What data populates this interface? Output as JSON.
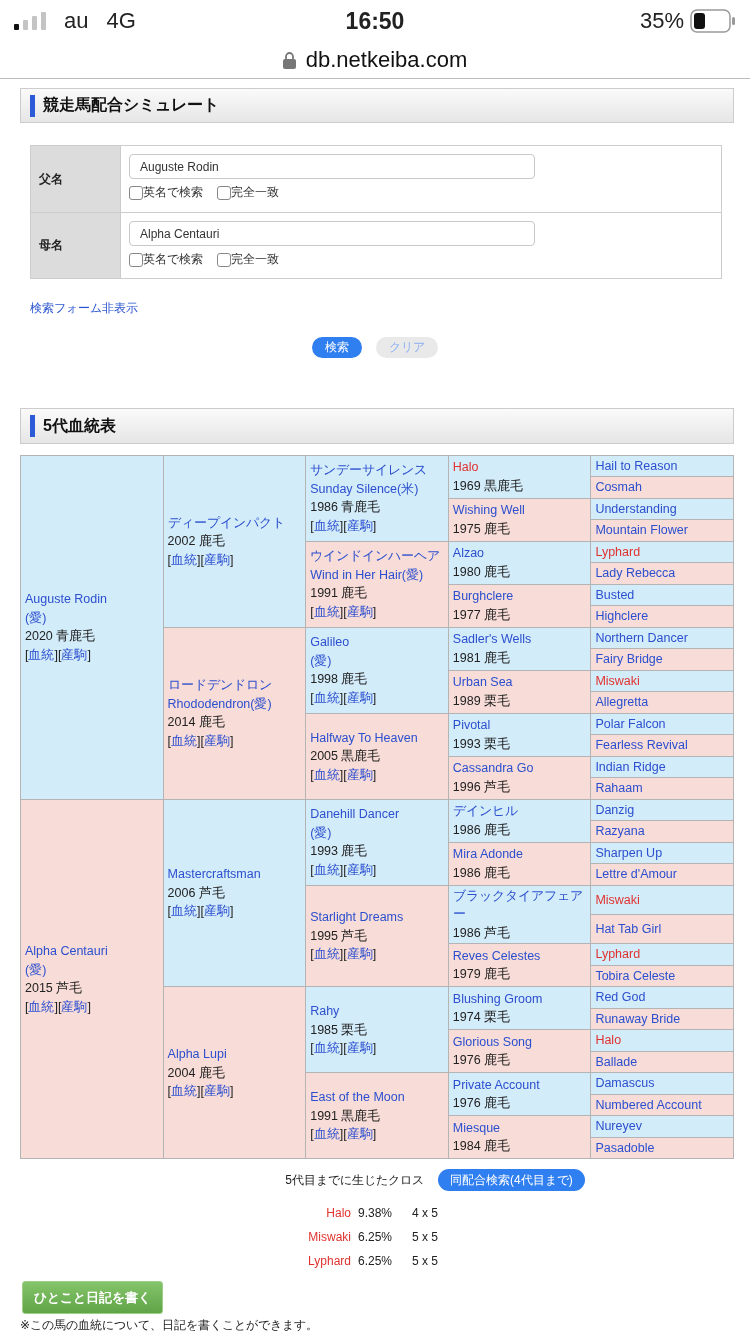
{
  "status_bar": {
    "carrier": "au",
    "network": "4G",
    "time": "16:50",
    "battery": "35%"
  },
  "url": "db.netkeiba.com",
  "search_section": {
    "title": "競走馬配合シミュレート",
    "fields": [
      {
        "label": "父名",
        "value": "Auguste Rodin",
        "options": [
          {
            "label": "英名で検索",
            "checked": false
          },
          {
            "label": "完全一致",
            "checked": false
          }
        ]
      },
      {
        "label": "母名",
        "value": "Alpha Centauri",
        "options": [
          {
            "label": "英名で検索",
            "checked": false
          },
          {
            "label": "完全一致",
            "checked": false
          }
        ]
      }
    ],
    "toggle_link": "検索フォーム非表示",
    "buttons": [
      {
        "label": "検索",
        "kind": "primary"
      },
      {
        "label": "クリア",
        "kind": "secondary"
      }
    ]
  },
  "pedigree": {
    "title": "5代血統表",
    "horses": [
      {
        "kind": "sire",
        "cross": false,
        "names": [
          "Auguste Rodin",
          "(愛)"
        ],
        "info": "2020 青鹿毛",
        "links": [
          "[血統]",
          "[産駒]"
        ],
        "children": [
          {
            "kind": "sire",
            "cross": false,
            "names": [
              "ディープインパクト"
            ],
            "info": "2002 鹿毛",
            "links": [
              "[血統]",
              "[産駒]"
            ],
            "children": [
              {
                "kind": "sire",
                "cross": false,
                "names": [
                  "サンデーサイレンス",
                  "Sunday Silence(米)"
                ],
                "info": "1986 青鹿毛",
                "links": [
                  "[血統]",
                  "[産駒]"
                ],
                "children": [
                  {
                    "kind": "sire",
                    "cross": true,
                    "names": [
                      "Halo"
                    ],
                    "info": "1969 黒鹿毛",
                    "children": [
                      {
                        "kind": "sire",
                        "cross": false,
                        "names": [
                          "Hail to Reason"
                        ]
                      },
                      {
                        "kind": "dam",
                        "cross": false,
                        "names": [
                          "Cosmah"
                        ]
                      }
                    ]
                  },
                  {
                    "kind": "dam",
                    "cross": false,
                    "names": [
                      "Wishing Well"
                    ],
                    "info": "1975 鹿毛",
                    "children": [
                      {
                        "kind": "sire",
                        "cross": false,
                        "names": [
                          "Understanding"
                        ]
                      },
                      {
                        "kind": "dam",
                        "cross": false,
                        "names": [
                          "Mountain Flower"
                        ]
                      }
                    ]
                  }
                ]
              },
              {
                "kind": "dam",
                "cross": false,
                "names": [
                  "ウインドインハーヘア",
                  "Wind in Her Hair(愛)"
                ],
                "info": "1991 鹿毛",
                "links": [
                  "[血統]",
                  "[産駒]"
                ],
                "children": [
                  {
                    "kind": "sire",
                    "cross": false,
                    "names": [
                      "Alzao"
                    ],
                    "info": "1980 鹿毛",
                    "children": [
                      {
                        "kind": "sire",
                        "cross": true,
                        "names": [
                          "Lyphard"
                        ]
                      },
                      {
                        "kind": "dam",
                        "cross": false,
                        "names": [
                          "Lady Rebecca"
                        ]
                      }
                    ]
                  },
                  {
                    "kind": "dam",
                    "cross": false,
                    "names": [
                      "Burghclere"
                    ],
                    "info": "1977 鹿毛",
                    "children": [
                      {
                        "kind": "sire",
                        "cross": false,
                        "names": [
                          "Busted"
                        ]
                      },
                      {
                        "kind": "dam",
                        "cross": false,
                        "names": [
                          "Highclere"
                        ]
                      }
                    ]
                  }
                ]
              }
            ]
          },
          {
            "kind": "dam",
            "cross": false,
            "names": [
              "ロードデンドロン",
              "Rhododendron(愛)"
            ],
            "info": "2014 鹿毛",
            "links": [
              "[血統]",
              "[産駒]"
            ],
            "children": [
              {
                "kind": "sire",
                "cross": false,
                "names": [
                  "Galileo",
                  "(愛)"
                ],
                "info": "1998 鹿毛",
                "links": [
                  "[血統]",
                  "[産駒]"
                ],
                "children": [
                  {
                    "kind": "sire",
                    "cross": false,
                    "names": [
                      "Sadler's Wells"
                    ],
                    "info": "1981 鹿毛",
                    "children": [
                      {
                        "kind": "sire",
                        "cross": false,
                        "names": [
                          "Northern Dancer"
                        ]
                      },
                      {
                        "kind": "dam",
                        "cross": false,
                        "names": [
                          "Fairy Bridge"
                        ]
                      }
                    ]
                  },
                  {
                    "kind": "dam",
                    "cross": false,
                    "names": [
                      "Urban Sea"
                    ],
                    "info": "1989 栗毛",
                    "children": [
                      {
                        "kind": "sire",
                        "cross": true,
                        "names": [
                          "Miswaki"
                        ]
                      },
                      {
                        "kind": "dam",
                        "cross": false,
                        "names": [
                          "Allegretta"
                        ]
                      }
                    ]
                  }
                ]
              },
              {
                "kind": "dam",
                "cross": false,
                "names": [
                  "Halfway To Heaven"
                ],
                "info": "2005 黒鹿毛",
                "links": [
                  "[血統]",
                  "[産駒]"
                ],
                "children": [
                  {
                    "kind": "sire",
                    "cross": false,
                    "names": [
                      "Pivotal"
                    ],
                    "info": "1993 栗毛",
                    "children": [
                      {
                        "kind": "sire",
                        "cross": false,
                        "names": [
                          "Polar Falcon"
                        ]
                      },
                      {
                        "kind": "dam",
                        "cross": false,
                        "names": [
                          "Fearless Revival"
                        ]
                      }
                    ]
                  },
                  {
                    "kind": "dam",
                    "cross": false,
                    "names": [
                      "Cassandra Go"
                    ],
                    "info": "1996 芦毛",
                    "children": [
                      {
                        "kind": "sire",
                        "cross": false,
                        "names": [
                          "Indian Ridge"
                        ]
                      },
                      {
                        "kind": "dam",
                        "cross": false,
                        "names": [
                          "Rahaam"
                        ]
                      }
                    ]
                  }
                ]
              }
            ]
          }
        ]
      },
      {
        "kind": "dam",
        "cross": false,
        "names": [
          "Alpha Centauri",
          "(愛)"
        ],
        "info": "2015 芦毛",
        "links": [
          "[血統]",
          "[産駒]"
        ],
        "children": [
          {
            "kind": "sire",
            "cross": false,
            "names": [
              "Mastercraftsman"
            ],
            "info": "2006 芦毛",
            "links": [
              "[血統]",
              "[産駒]"
            ],
            "children": [
              {
                "kind": "sire",
                "cross": false,
                "names": [
                  "Danehill Dancer",
                  "(愛)"
                ],
                "info": "1993 鹿毛",
                "links": [
                  "[血統]",
                  "[産駒]"
                ],
                "children": [
                  {
                    "kind": "sire",
                    "cross": false,
                    "names": [
                      "デインヒル"
                    ],
                    "info": "1986 鹿毛",
                    "children": [
                      {
                        "kind": "sire",
                        "cross": false,
                        "names": [
                          "Danzig"
                        ]
                      },
                      {
                        "kind": "dam",
                        "cross": false,
                        "names": [
                          "Razyana"
                        ]
                      }
                    ]
                  },
                  {
                    "kind": "dam",
                    "cross": false,
                    "names": [
                      "Mira Adonde"
                    ],
                    "info": "1986 鹿毛",
                    "children": [
                      {
                        "kind": "sire",
                        "cross": false,
                        "names": [
                          "Sharpen Up"
                        ]
                      },
                      {
                        "kind": "dam",
                        "cross": false,
                        "names": [
                          "Lettre d'Amour"
                        ]
                      }
                    ]
                  }
                ]
              },
              {
                "kind": "dam",
                "cross": false,
                "names": [
                  "Starlight Dreams"
                ],
                "info": "1995 芦毛",
                "links": [
                  "[血統]",
                  "[産駒]"
                ],
                "children": [
                  {
                    "kind": "sire",
                    "cross": false,
                    "names": [
                      "ブラックタイアフェアー"
                    ],
                    "info": "1986 芦毛",
                    "children": [
                      {
                        "kind": "sire",
                        "cross": true,
                        "names": [
                          "Miswaki"
                        ]
                      },
                      {
                        "kind": "dam",
                        "cross": false,
                        "names": [
                          "Hat Tab Girl"
                        ]
                      }
                    ]
                  },
                  {
                    "kind": "dam",
                    "cross": false,
                    "names": [
                      "Reves Celestes"
                    ],
                    "info": "1979 鹿毛",
                    "children": [
                      {
                        "kind": "sire",
                        "cross": true,
                        "names": [
                          "Lyphard"
                        ]
                      },
                      {
                        "kind": "dam",
                        "cross": false,
                        "names": [
                          "Tobira Celeste"
                        ]
                      }
                    ]
                  }
                ]
              }
            ]
          },
          {
            "kind": "dam",
            "cross": false,
            "names": [
              "Alpha Lupi"
            ],
            "info": "2004 鹿毛",
            "links": [
              "[血統]",
              "[産駒]"
            ],
            "children": [
              {
                "kind": "sire",
                "cross": false,
                "names": [
                  "Rahy"
                ],
                "info": "1985 栗毛",
                "links": [
                  "[血統]",
                  "[産駒]"
                ],
                "children": [
                  {
                    "kind": "sire",
                    "cross": false,
                    "names": [
                      "Blushing Groom"
                    ],
                    "info": "1974 栗毛",
                    "children": [
                      {
                        "kind": "sire",
                        "cross": false,
                        "names": [
                          "Red God"
                        ]
                      },
                      {
                        "kind": "dam",
                        "cross": false,
                        "names": [
                          "Runaway Bride"
                        ]
                      }
                    ]
                  },
                  {
                    "kind": "dam",
                    "cross": false,
                    "names": [
                      "Glorious Song"
                    ],
                    "info": "1976 鹿毛",
                    "children": [
                      {
                        "kind": "sire",
                        "cross": true,
                        "names": [
                          "Halo"
                        ]
                      },
                      {
                        "kind": "dam",
                        "cross": false,
                        "names": [
                          "Ballade"
                        ]
                      }
                    ]
                  }
                ]
              },
              {
                "kind": "dam",
                "cross": false,
                "names": [
                  "East of the Moon"
                ],
                "info": "1991 黒鹿毛",
                "links": [
                  "[血統]",
                  "[産駒]"
                ],
                "children": [
                  {
                    "kind": "sire",
                    "cross": false,
                    "names": [
                      "Private Account"
                    ],
                    "info": "1976 鹿毛",
                    "children": [
                      {
                        "kind": "sire",
                        "cross": false,
                        "names": [
                          "Damascus"
                        ]
                      },
                      {
                        "kind": "dam",
                        "cross": false,
                        "names": [
                          "Numbered Account"
                        ]
                      }
                    ]
                  },
                  {
                    "kind": "dam",
                    "cross": false,
                    "names": [
                      "Miesque"
                    ],
                    "info": "1984 鹿毛",
                    "children": [
                      {
                        "kind": "sire",
                        "cross": false,
                        "names": [
                          "Nureyev"
                        ]
                      },
                      {
                        "kind": "dam",
                        "cross": false,
                        "names": [
                          "Pasadoble"
                        ]
                      }
                    ]
                  }
                ]
              }
            ]
          }
        ]
      }
    ]
  },
  "crosses": {
    "caption": "5代目までに生じたクロス",
    "search_button": "同配合検索(4代目まで)",
    "rows": [
      {
        "name": "Halo",
        "percent": "9.38%",
        "pattern": "4 x 5"
      },
      {
        "name": "Miswaki",
        "percent": "6.25%",
        "pattern": "5 x 5"
      },
      {
        "name": "Lyphard",
        "percent": "6.25%",
        "pattern": "5 x 5"
      }
    ]
  },
  "diary_button": "ひとこと日記を書く",
  "note": "※この馬の血統について、日記を書くことができます。"
}
